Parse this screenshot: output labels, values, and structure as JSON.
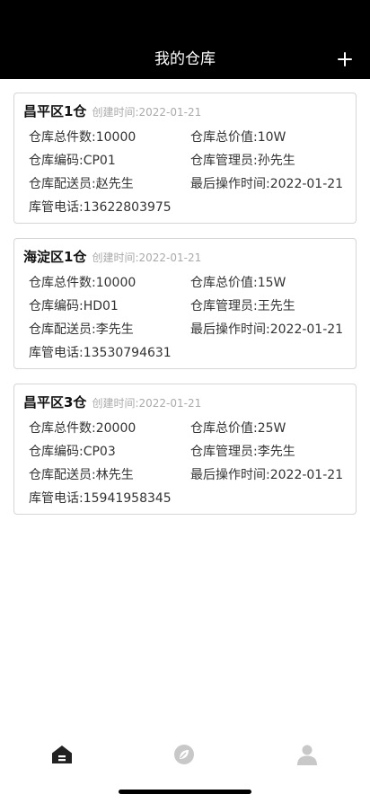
{
  "header": {
    "title": "我的仓库",
    "add_icon": "plus-icon"
  },
  "warehouses": [
    {
      "name": "昌平区1仓",
      "created": "创建时间:2022-01-21",
      "total_count": "仓库总件数:10000",
      "total_value": "仓库总价值:10W",
      "code": "仓库编码:CP01",
      "manager": "仓库管理员:孙先生",
      "courier": "仓库配送员:赵先生",
      "last_op": "最后操作时间:2022-01-21",
      "phone": "库管电话:13622803975"
    },
    {
      "name": "海淀区1仓",
      "created": "创建时间:2022-01-21",
      "total_count": "仓库总件数:10000",
      "total_value": "仓库总价值:15W",
      "code": "仓库编码:HD01",
      "manager": "仓库管理员:王先生",
      "courier": "仓库配送员:李先生",
      "last_op": "最后操作时间:2022-01-21",
      "phone": "库管电话:13530794631"
    },
    {
      "name": "昌平区3仓",
      "created": "创建时间:2022-01-21",
      "total_count": "仓库总件数:20000",
      "total_value": "仓库总价值:25W",
      "code": "仓库编码:CP03",
      "manager": "仓库管理员:李先生",
      "courier": "仓库配送员:林先生",
      "last_op": "最后操作时间:2022-01-21",
      "phone": "库管电话:15941958345"
    }
  ],
  "tabbar": {
    "items": [
      {
        "icon": "home-icon",
        "active": true
      },
      {
        "icon": "compass-icon",
        "active": false
      },
      {
        "icon": "user-icon",
        "active": false
      }
    ],
    "active_color": "#222222",
    "inactive_color": "#c8c8c8"
  },
  "colors": {
    "header_bg": "#000000",
    "card_border": "#d6d6d6",
    "muted_text": "#aaaaaa"
  }
}
